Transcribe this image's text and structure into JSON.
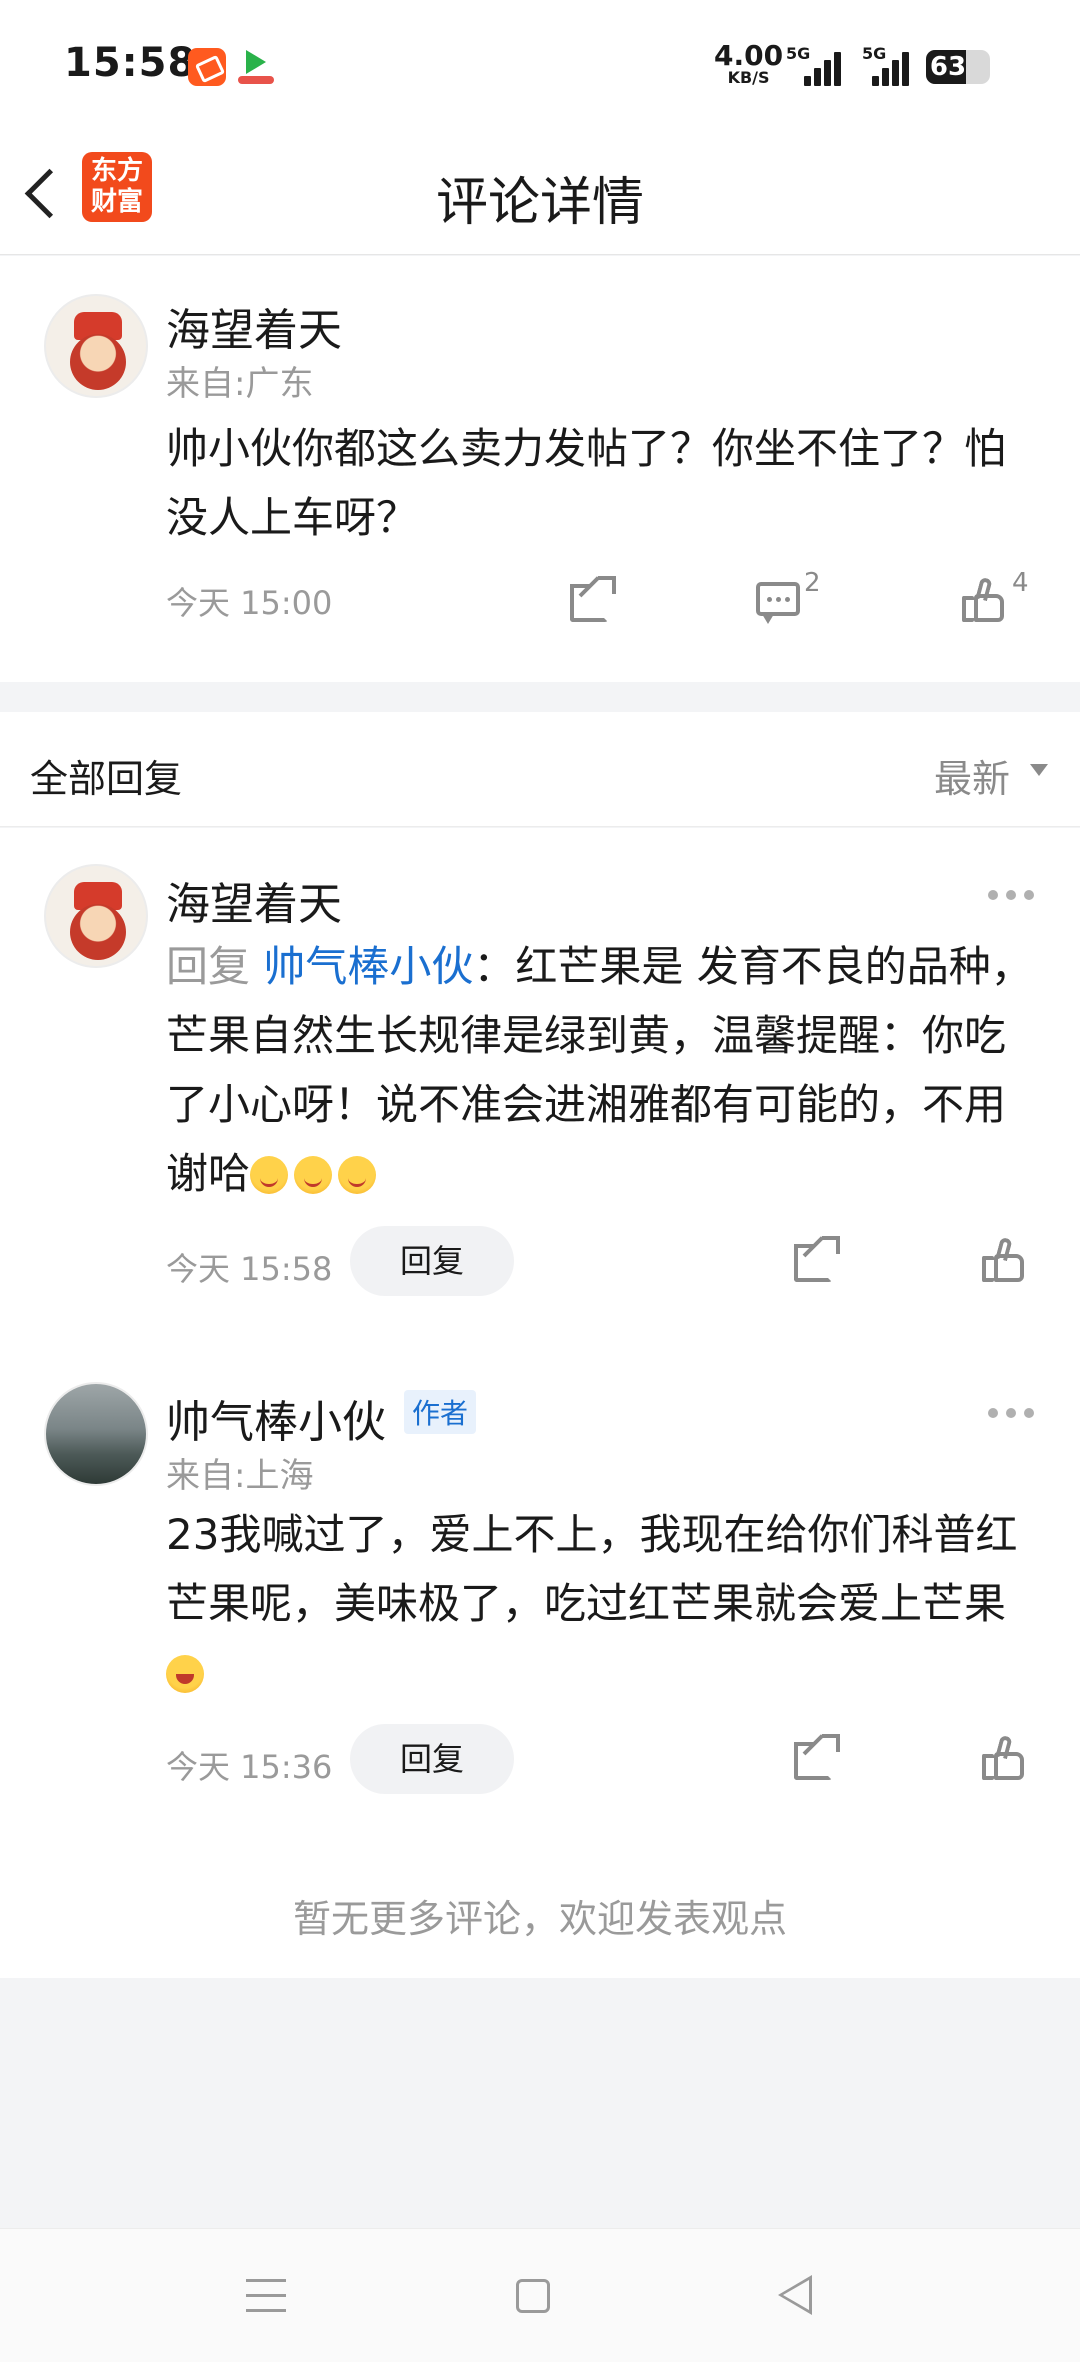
{
  "status_bar": {
    "time": "15:58",
    "net_speed": "4.00",
    "net_speed_unit": "KB/S",
    "network_1": "5G",
    "network_2": "5G",
    "battery": "63",
    "battery_level": 0.63
  },
  "header": {
    "logo_line1": "东方",
    "logo_line2": "财富",
    "title": "评论详情"
  },
  "main_comment": {
    "username": "海望着天",
    "location": "来自:广东",
    "content": "帅小伙你都这么卖力发帖了？你坐不住了？怕没人上车呀？",
    "time": "今天 15:00",
    "comment_count": "2",
    "like_count": "4"
  },
  "replies_section": {
    "title": "全部回复",
    "sort_label": "最新",
    "end_note": "暂无更多评论，欢迎发表观点"
  },
  "replies": [
    {
      "username": "海望着天",
      "reply_prefix": "回复 ",
      "reply_target": "帅气棒小伙",
      "content": "：红芒果是 发育不良的品种，芒果自然生长规律是绿到黄，温馨提醒：你吃了小心呀！说不准会进湘雅都有可能的，不用谢哈",
      "time": "今天 15:58",
      "reply_button": "回复"
    },
    {
      "username": "帅气棒小伙",
      "badge": "作者",
      "location": "来自:上海",
      "content": "23我喊过了，爱上不上，我现在给你们科普红芒果呢，美味极了，吃过红芒果就会爱上芒果",
      "time": "今天 15:36",
      "reply_button": "回复"
    }
  ],
  "icons": {
    "back": "back-arrow-icon",
    "share": "share-icon",
    "comment": "comment-icon",
    "like": "like-icon",
    "more": "more-icon",
    "sort": "caret-down-icon"
  },
  "colors": {
    "accent_orange": "#f24a1c",
    "link_blue": "#1a6fd0",
    "muted_gray": "#9a9a9a"
  }
}
